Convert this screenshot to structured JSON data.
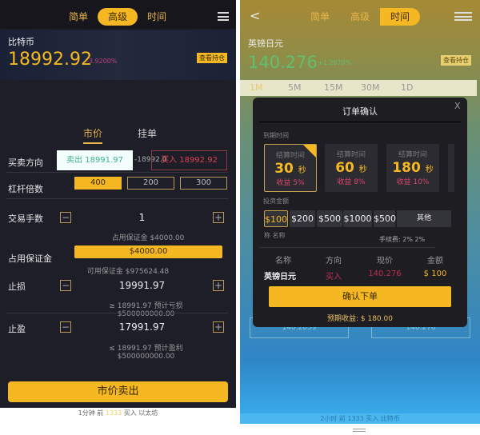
{
  "left": {
    "nav": {
      "tabs": [
        "简单",
        "高级",
        "时间"
      ],
      "active": 1,
      "menu_icon": "hamburger-icon"
    },
    "asset": {
      "name": "比特币",
      "price": "18992.92",
      "change": "-3.9200%",
      "view_positions": "查看持仓"
    },
    "order_tabs": [
      "市价",
      "挂单"
    ],
    "active_order_tab": 0,
    "direction": {
      "label": "买卖方向",
      "sell": "卖出 18991.97",
      "spread": "-18992.0",
      "buy": "买入 18992.92"
    },
    "leverage": {
      "label": "杠杆倍数",
      "options": [
        "400",
        "200",
        "300"
      ],
      "selected": 0
    },
    "lots": {
      "label": "交易手数",
      "value": "1",
      "note": "占用保证金 $4000.00"
    },
    "margin": {
      "label": "占用保证金",
      "value": "$4000.00",
      "note": "可用保证金 $975624.48"
    },
    "stop_loss": {
      "label": "止损",
      "value": "19991.97",
      "note": "≥ 18991.97 预计亏损 $500000000.00"
    },
    "take_profit": {
      "label": "止盈",
      "value": "17991.97",
      "note": "≤ 18991.97 预计盈利 $500000000.00"
    },
    "submit": "市价卖出",
    "footer": {
      "prefix": "1分钟 前",
      "count": "1333",
      "suffix": "买入 以太坊"
    }
  },
  "right": {
    "nav": {
      "tabs": [
        "简单",
        "高级",
        "时间"
      ],
      "active": 2
    },
    "asset": {
      "name": "英镑日元",
      "price": "140.276",
      "change": "+1.2870%",
      "view_positions": "查看持仓"
    },
    "timeframes": [
      "1M",
      "5M",
      "15M",
      "30M",
      "1D"
    ],
    "active_timeframe": 0,
    "background_prices": [
      "140.2059",
      "140.276"
    ],
    "modal": {
      "title": "订单确认",
      "close": "X",
      "expiry_label": "到期时间",
      "cards": [
        {
          "title": "结算时间",
          "seconds": "30",
          "unit": "秒",
          "yield": "收益 5%"
        },
        {
          "title": "结算时间",
          "seconds": "60",
          "unit": "秒",
          "yield": "收益 8%"
        },
        {
          "title": "结算时间",
          "seconds": "180",
          "unit": "秒",
          "yield": "收益 10%"
        }
      ],
      "selected_card": 0,
      "amount_label": "投资金额",
      "amounts": [
        "$100",
        "$200",
        "$500",
        "$1000",
        "$500",
        "其他"
      ],
      "selected_amount": 0,
      "name_row": "称  名称",
      "fee": "手续费:  2%   2%",
      "table": {
        "headers": [
          "名称",
          "方向",
          "现价",
          "金额"
        ],
        "row": [
          "英镑日元",
          "买入",
          "140.276",
          "$ 100"
        ]
      },
      "confirm": "确认下单",
      "expected": "预期收益: $ 180.00"
    },
    "footer": "2小时 前 1333 买入 比特币"
  },
  "colors": {
    "accent": "#f5b823",
    "up": "#4cbf6a",
    "down": "#d8456b"
  }
}
